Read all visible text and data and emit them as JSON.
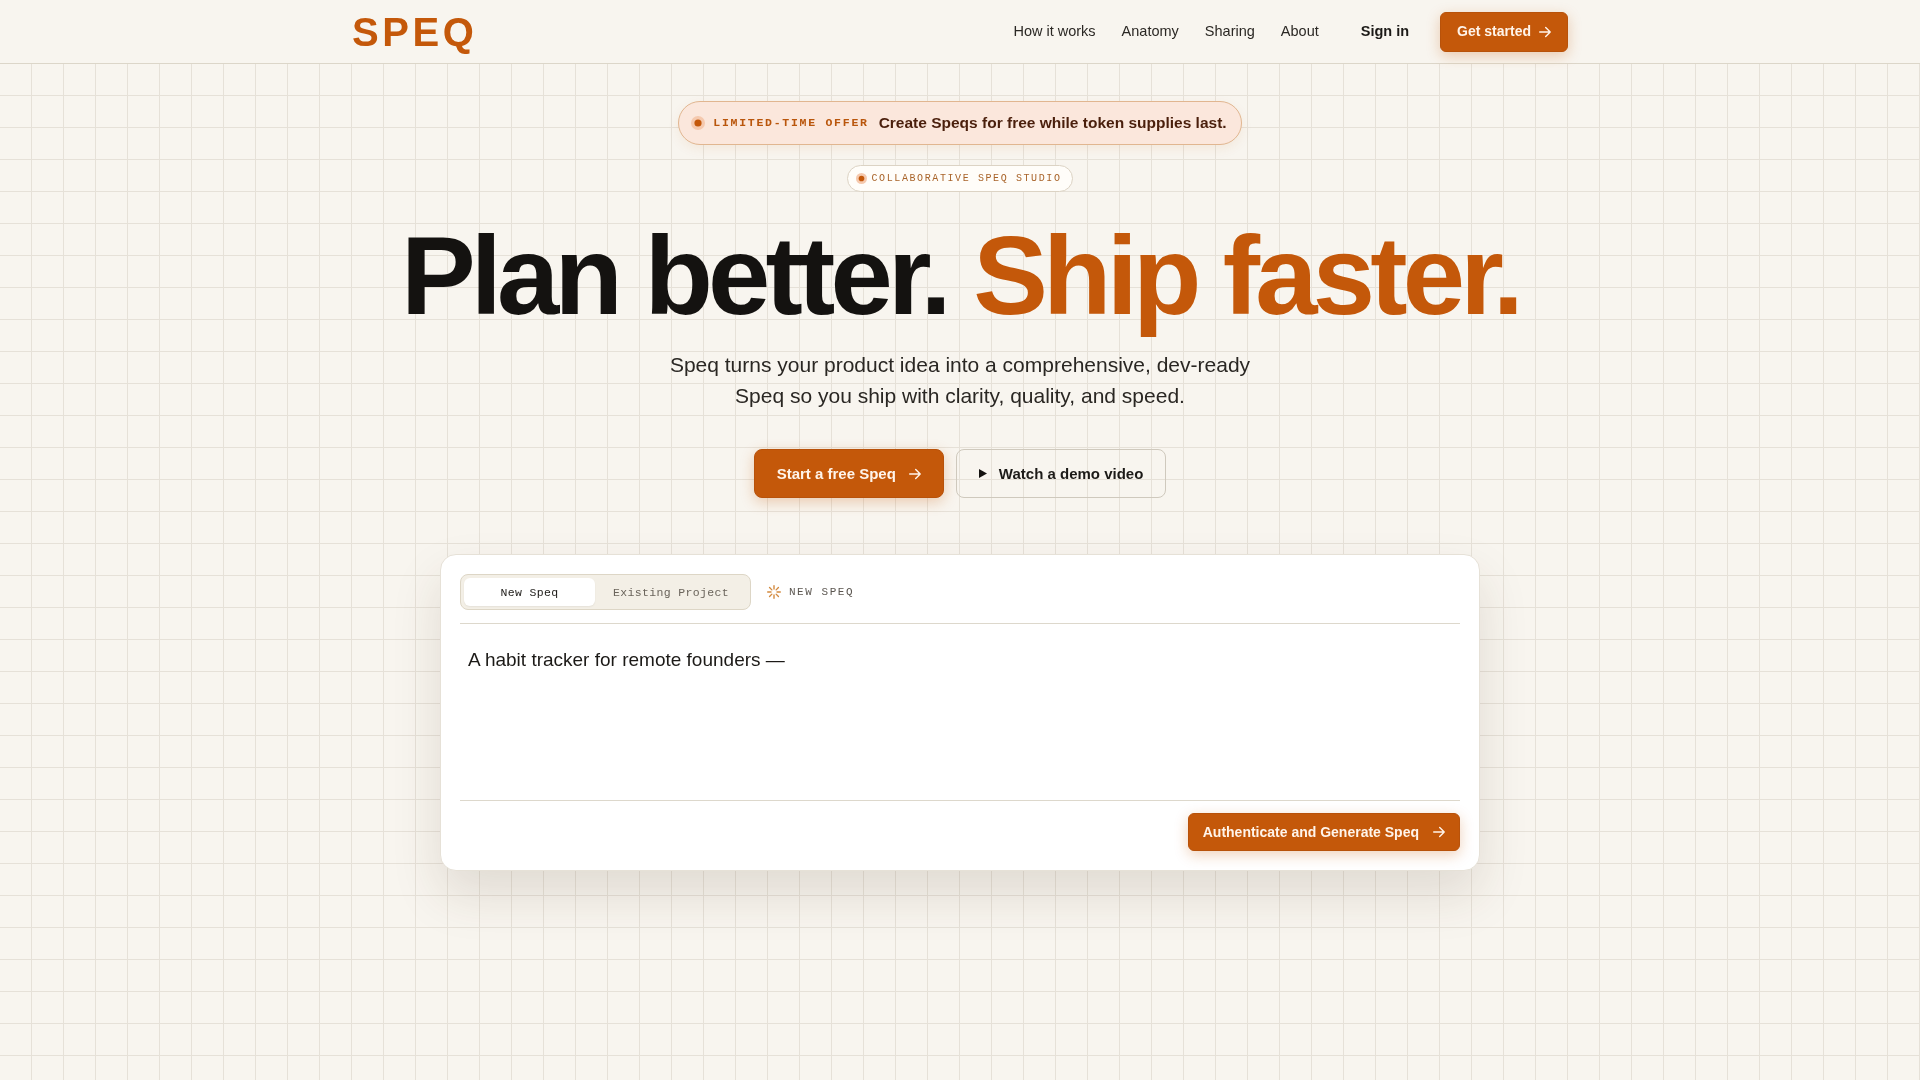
{
  "header": {
    "logo": "SPEQ",
    "nav_links": [
      "How it works",
      "Anatomy",
      "Sharing",
      "About"
    ],
    "sign_in": "Sign in",
    "cta": "Get started"
  },
  "offer_banner": {
    "tag": "LIMITED-TIME OFFER",
    "text": "Create Speqs for free while token supplies last."
  },
  "eyebrow": "COLLABORATIVE SPEQ STUDIO",
  "headline": [
    {
      "text": "Plan better.",
      "kind": "plain"
    },
    {
      "text": "Ship faster.",
      "kind": "accent"
    }
  ],
  "subtitle": "Speq turns your product idea into a comprehensive, dev-ready Speq so you ship with clarity, quality, and speed.",
  "actions": [
    {
      "label": "Start a free Speq",
      "kind": "primary"
    },
    {
      "label": "Watch a demo video",
      "kind": "secondary"
    }
  ],
  "composer": {
    "tabs": [
      {
        "label": "New Speq",
        "selected": true
      },
      {
        "label": "Existing Project",
        "selected": false
      }
    ],
    "mode_label": "NEW SPEQ",
    "input": {
      "value": "A habit tracker for remote founders —"
    },
    "submit": "Authenticate and Generate Speq"
  }
}
